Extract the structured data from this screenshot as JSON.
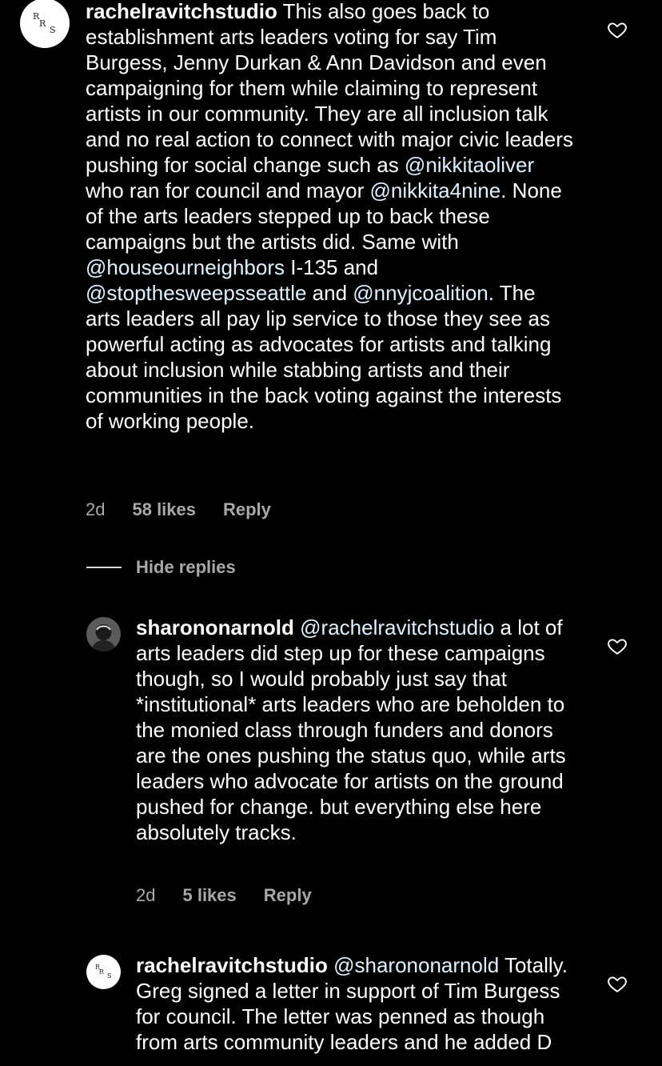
{
  "comments": [
    {
      "username": "rachelravitchstudio",
      "avatar_initials": [
        "R",
        "R",
        "S"
      ],
      "body_parts": [
        {
          "t": "This also goes back to establishment arts leaders voting for say Tim Burgess, Jenny Durkan & Ann Davidson and even campaigning for them while claiming to represent artists in our community. They are all inclusion talk and no real action to connect with major civic leaders pushing for social change such as ",
          "m": false
        },
        {
          "t": "@nikkitaoliver",
          "m": true
        },
        {
          "t": " who ran for council and mayor ",
          "m": false
        },
        {
          "t": "@nikkita4nine",
          "m": true
        },
        {
          "t": ". None of the arts leaders stepped up to back these campaigns but the artists did. Same with ",
          "m": false
        },
        {
          "t": "@houseourneighbors",
          "m": true
        },
        {
          "t": " I-135 and ",
          "m": false
        },
        {
          "t": "@stopthesweepsseattle",
          "m": true
        },
        {
          "t": " and ",
          "m": false
        },
        {
          "t": "@nnyjcoalition",
          "m": true
        },
        {
          "t": ". The arts leaders all pay lip service to those they see as powerful acting as advocates for artists and talking about inclusion while stabbing artists and their communities in the back voting against the interests of working people.",
          "m": false
        }
      ],
      "time": "2d",
      "likes": "58 likes",
      "reply": "Reply"
    },
    {
      "username": "sharononarnold",
      "body_parts": [
        {
          "t": "@rachelravitchstudio",
          "m": true
        },
        {
          "t": " a lot of arts leaders did step up for these campaigns though, so I would probably just say that *institutional* arts leaders who are beholden to the monied class through funders and donors are the ones pushing the status quo, while arts leaders who advocate for artists on the ground pushed for change. but everything else here absolutely tracks.",
          "m": false
        }
      ],
      "time": "2d",
      "likes": "5 likes",
      "reply": "Reply"
    },
    {
      "username": "rachelravitchstudio",
      "avatar_initials": [
        "R",
        "R",
        "S"
      ],
      "body_parts": [
        {
          "t": "@sharononarnold",
          "m": true
        },
        {
          "t": " Totally. Greg signed a letter in support of Tim Burgess for council. The letter was penned as though from arts community leaders and he added D",
          "m": false
        }
      ]
    }
  ],
  "hide_replies_label": "Hide replies",
  "icons": {
    "like": "heart-outline-icon"
  }
}
